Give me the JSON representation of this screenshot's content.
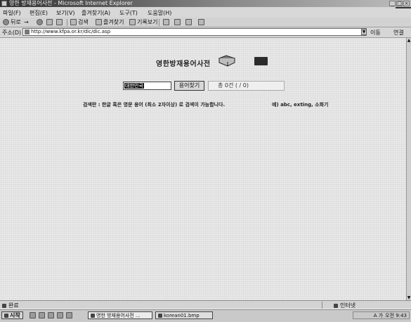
{
  "window": {
    "title": "영한 방재용어사전 - Microsoft Internet Explorer",
    "controls": {
      "minimize": "_",
      "maximize": "□",
      "close": "×"
    }
  },
  "menu": [
    "파일(F)",
    "편집(E)",
    "보기(V)",
    "즐겨찾기(A)",
    "도구(T)",
    "도움말(H)"
  ],
  "toolbar": {
    "back": "뒤로",
    "forward": "→",
    "search": "검색",
    "favorites": "즐겨찾기",
    "history": "기록보기"
  },
  "address": {
    "label": "주소(D)",
    "url": "http://www.kfpa.or.kr/dic/dic.asp",
    "go": "이동",
    "links": "연결"
  },
  "page": {
    "title": "영한방재용어사전",
    "search_value": "대한민국",
    "search_button": "용어찾기",
    "count_text": "총 0건 ( / 0)",
    "help_text": "검색란 : 한글 혹은 영문 용어 (최소 2자이상) 로 검색이 가능합니다.",
    "help_example": "예) abc, exting, 소화기"
  },
  "status": {
    "left": "완료",
    "zone": "인터넷"
  },
  "taskbar": {
    "start": "시작",
    "tasks": [
      "영한 방재용어사전 ...",
      "korean01.bmp"
    ],
    "clock": "오전 9:43",
    "ime": "A 가"
  }
}
